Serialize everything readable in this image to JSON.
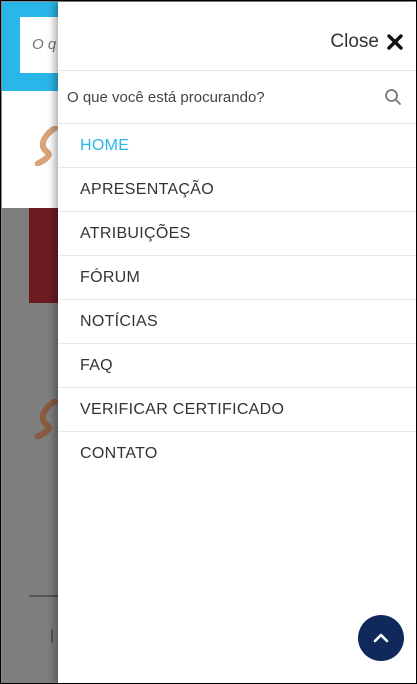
{
  "background": {
    "search_placeholder_fragment": "O q"
  },
  "drawer": {
    "close_label": "Close",
    "search": {
      "placeholder": "O que você está procurando?"
    },
    "menu": [
      {
        "label": "HOME",
        "active": true
      },
      {
        "label": "APRESENTAÇÃO",
        "active": false
      },
      {
        "label": "ATRIBUIÇÕES",
        "active": false
      },
      {
        "label": "FÓRUM",
        "active": false
      },
      {
        "label": "NOTÍCIAS",
        "active": false
      },
      {
        "label": "FAQ",
        "active": false
      },
      {
        "label": "VERIFICAR CERTIFICADO",
        "active": false
      },
      {
        "label": "CONTATO",
        "active": false
      }
    ],
    "scroll_top_icon": "chevron-up-icon"
  },
  "colors": {
    "accent": "#29b6e8",
    "scroll_button": "#0f2a5a",
    "maroon": "#6d1b21",
    "overlay_gray": "#7e7e7e"
  }
}
